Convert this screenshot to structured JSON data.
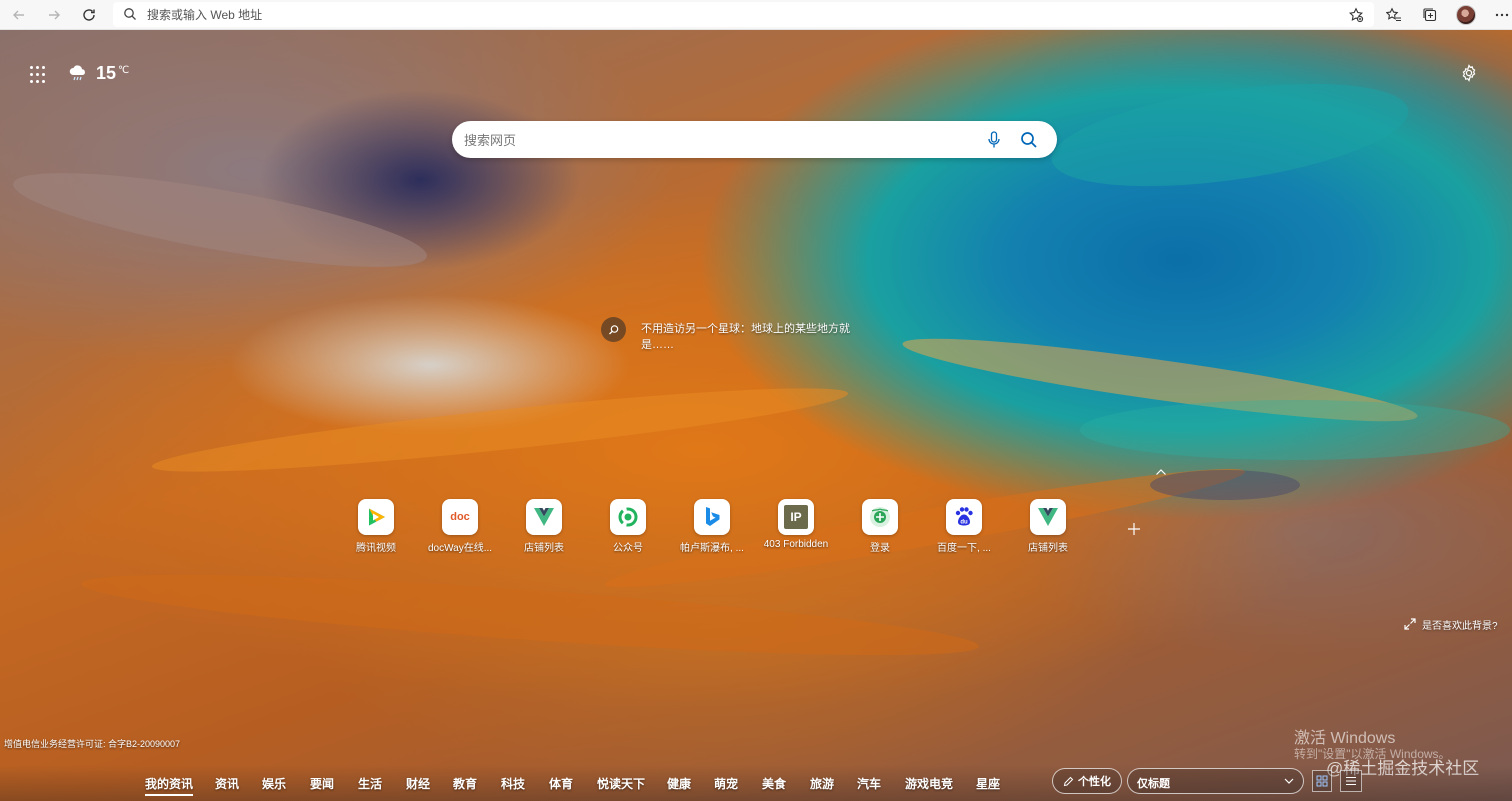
{
  "browser": {
    "address_placeholder": "搜索或输入 Web 地址"
  },
  "weather": {
    "temperature": "15",
    "unit": "℃"
  },
  "search": {
    "placeholder": "搜索网页"
  },
  "image_info": {
    "caption": "不用造访另一个星球：地球上的某些地方就是……"
  },
  "quick_links": [
    {
      "label": "腾讯视频",
      "icon": "tencent-video-icon"
    },
    {
      "label": "docWay在线...",
      "icon": "docway-icon",
      "glyph": "doc"
    },
    {
      "label": "店铺列表",
      "icon": "vue-icon"
    },
    {
      "label": "公众号",
      "icon": "wechat-mp-icon"
    },
    {
      "label": "帕卢斯瀑布, ...",
      "icon": "bing-icon"
    },
    {
      "label": "403 Forbidden",
      "icon": "ip-icon",
      "glyph": "IP"
    },
    {
      "label": "登录",
      "icon": "login-icon"
    },
    {
      "label": "百度一下, ...",
      "icon": "baidu-icon",
      "glyph": "du"
    },
    {
      "label": "店铺列表",
      "icon": "vue-icon"
    }
  ],
  "like_background": "是否喜欢此背景?",
  "license": "增值电信业务经营许可证: 合字B2-20090007",
  "watermark": {
    "line1": "激活 Windows",
    "line2": "转到\"设置\"以激活 Windows。",
    "line3": "@稀土掘金技术社区"
  },
  "news_tabs": [
    "我的资讯",
    "资讯",
    "娱乐",
    "要闻",
    "生活",
    "财经",
    "教育",
    "科技",
    "体育",
    "悦读天下",
    "健康",
    "萌宠",
    "美食",
    "旅游",
    "汽车",
    "游戏电竞",
    "星座"
  ],
  "personalize_label": "个性化",
  "layout_select": {
    "value": "仅标题"
  },
  "colors": {
    "accent": "#0067b8",
    "vue_green": "#41b883",
    "tencent_blue": "#1fa1e6"
  }
}
